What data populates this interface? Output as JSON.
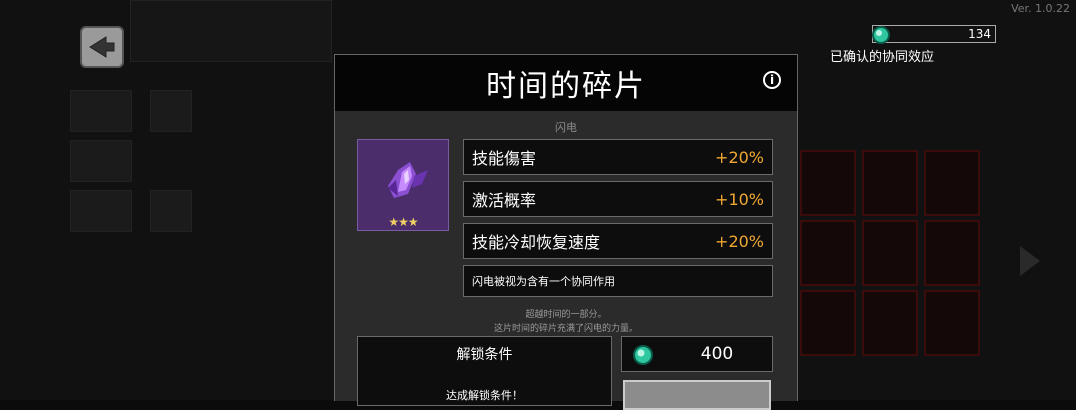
{
  "version": "Ver. 1.0.22",
  "currency": {
    "amount": "134",
    "icon": "gem-icon"
  },
  "synergy_link": "已确认的协同效应",
  "modal": {
    "title": "时间的碎片",
    "info_icon": "i",
    "category": "闪电",
    "item": {
      "icon": "crystal-shard-icon",
      "stars": "★★★"
    },
    "stats": [
      {
        "name": "技能傷害",
        "value": "+20%"
      },
      {
        "name": "激活概率",
        "value": "+10%"
      },
      {
        "name": "技能冷却恢复速度",
        "value": "+20%"
      }
    ],
    "synergy_note": "闪电被视为含有一个协同作用",
    "description_lines": [
      "超越时间的一部分。",
      "这片时间的碎片充满了闪电的力量。"
    ],
    "unlock": {
      "title": "解锁条件",
      "status": "达成解锁条件！"
    },
    "price": "400"
  },
  "colors": {
    "accent": "#f0a832",
    "item_bg": "#4a2d6a",
    "gem": "#2ec7a0"
  }
}
